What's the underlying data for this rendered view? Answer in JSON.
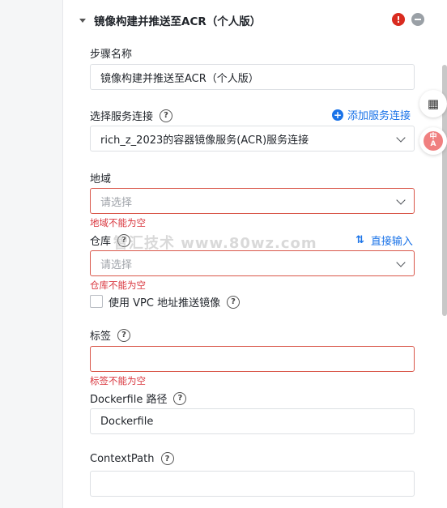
{
  "step": {
    "title": "镜像构建并推送至ACR（个人版）"
  },
  "fields": {
    "step_name": {
      "label": "步骤名称",
      "value": "镜像构建并推送至ACR（个人版）"
    },
    "service_connection": {
      "label": "选择服务连接",
      "value": "rich_z_2023的容器镜像服务(ACR)服务连接",
      "add_link": "添加服务连接"
    },
    "region": {
      "label": "地域",
      "placeholder": "请选择",
      "error": "地域不能为空"
    },
    "repository": {
      "label": "仓库",
      "placeholder": "请选择",
      "error": "仓库不能为空",
      "direct_input_link": "直接输入"
    },
    "vpc": {
      "label": "使用 VPC 地址推送镜像"
    },
    "tag": {
      "label": "标签",
      "value": "",
      "error": "标签不能为空"
    },
    "dockerfile": {
      "label": "Dockerfile 路径",
      "value": "Dockerfile"
    },
    "context_path": {
      "label": "ContextPath",
      "value": ""
    }
  },
  "watermark": "智汇技术 www.80wz.com",
  "icons": {
    "info": "info-icon",
    "remove": "remove-icon",
    "help": "question-circle-icon",
    "plus": "plus-circle-icon",
    "swap": "swap-icon",
    "chevron": "chevron-down-icon",
    "apps": "apps-grid-icon",
    "translate": "translate-icon"
  },
  "colors": {
    "accent": "#1a73e8",
    "error": "#d9363e",
    "info_badge": "#d92b1f"
  }
}
